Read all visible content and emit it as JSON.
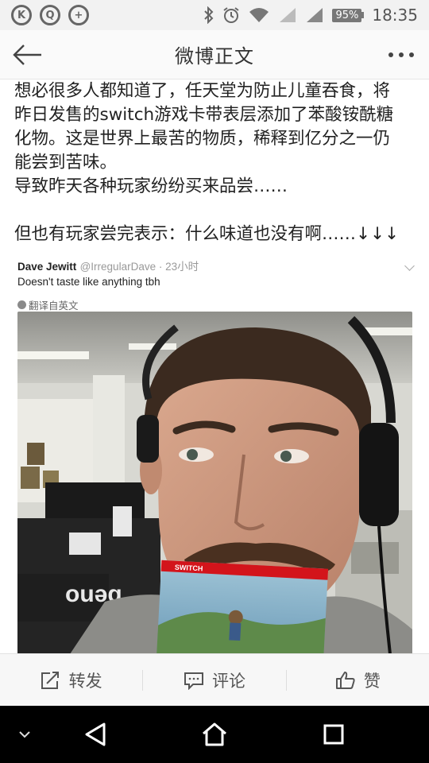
{
  "status_bar": {
    "left_apps": [
      {
        "icon": "k-app-icon",
        "glyph": "K"
      },
      {
        "icon": "q-app-icon",
        "glyph": "Q"
      },
      {
        "icon": "plus-app-icon",
        "glyph": "+"
      }
    ],
    "battery": "95%",
    "time": "18:35"
  },
  "nav": {
    "title": "微博正文"
  },
  "post": {
    "lines": [
      "想必很多人都知道了，任天堂为防止儿童吞食，将",
      "昨日发售的switch游戏卡带表层添加了苯酸铵酰糖",
      "化物。这是世界上最苦的物质，稀释到亿分之一仍",
      "能尝到苦味。",
      "导致昨天各种玩家纷纷买来品尝……",
      "但也有玩家尝完表示：什么味道也没有啊……↓↓↓"
    ]
  },
  "tweet": {
    "name": "Dave Jewitt",
    "handle": "@IrregularDave · 23小时",
    "body": "Doesn't taste like anything tbh",
    "translate": "翻译自英文"
  },
  "photo": {
    "cartridge_label": "SWITCH",
    "box_text": "ouəg"
  },
  "actions": [
    {
      "icon": "repost-icon",
      "label": "转发"
    },
    {
      "icon": "comment-icon",
      "label": "评论"
    },
    {
      "icon": "like-icon",
      "label": "赞"
    }
  ],
  "colors": {
    "status_bg": "#f2f2f2",
    "nav_bg": "#fafafa",
    "action_bg": "#f7f7f7",
    "sysnav_bg": "#000000"
  }
}
